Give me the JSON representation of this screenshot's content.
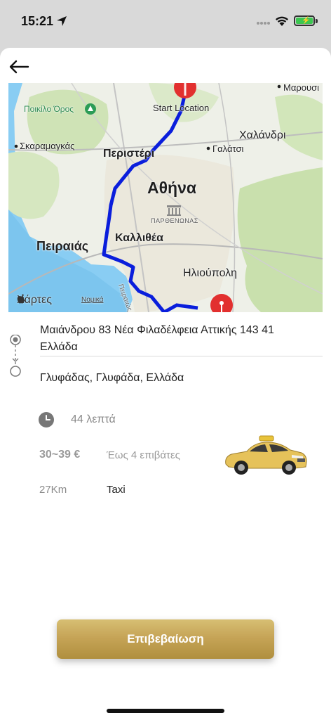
{
  "status_bar": {
    "time": "15:21",
    "icons": [
      "location-arrow-icon",
      "cellular-signal-icon",
      "wifi-icon",
      "battery-charging-icon"
    ]
  },
  "header": {
    "back_icon": "arrow-left-icon"
  },
  "map": {
    "labels": {
      "marousi": "Μαρουσι",
      "poikilo": "Ποικίλο Όρος",
      "start": "Start Location",
      "chalandri": "Χαλάνδρι",
      "skaramagkas": "Σκαραμαγκάς",
      "peristeri": "Περιστέρι",
      "galatsi": "Γαλάτσι",
      "athina": "Αθήνα",
      "parthenonas": "ΠΑΡΘΕΝΩΝΑΣ",
      "kallithea": "Καλλιθέα",
      "peiraias": "Πειραιάς",
      "ilioupoli": "Ηλιούπολη",
      "road": "Πειραιώς"
    },
    "attribution": "Χάρτες",
    "legal": "Νομικά",
    "route_color": "#0a1edc",
    "pin_color": "#e2302f"
  },
  "trip": {
    "from_address": "Μαιάνδρου 83  Νέα Φιλαδέλφεια Αττικής 143 41  Ελλάδα",
    "to_address": "Γλυφάδας, Γλυφάδα, Ελλάδα",
    "duration": "44 λεπτά",
    "price": "30~39 €",
    "passengers": "Έως 4 επιβάτες",
    "distance": "27Km",
    "vehicle_type": "Taxi"
  },
  "actions": {
    "confirm_label": "Επιβεβαίωση",
    "confirm_color": "#c6a457"
  }
}
